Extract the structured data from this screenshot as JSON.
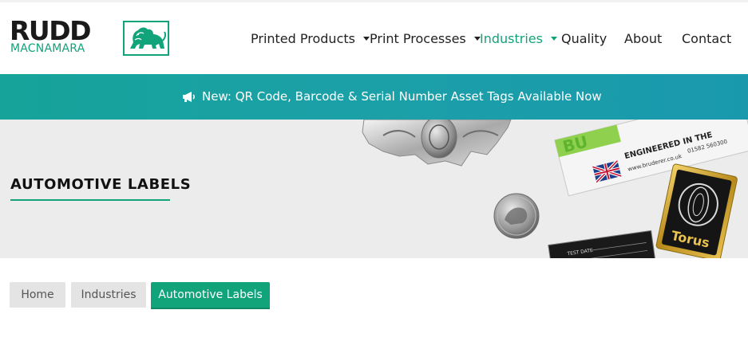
{
  "brand": {
    "name_top": "RUDD",
    "name_bottom": "MACNAMARA",
    "accent_color": "#11a37a",
    "logo_icon": "lion-icon"
  },
  "nav": {
    "items": [
      {
        "label": "Printed Products",
        "dropdown": true,
        "active": false
      },
      {
        "label": "Print Processes",
        "dropdown": true,
        "active": false
      },
      {
        "label": "Industries",
        "dropdown": true,
        "active": true
      },
      {
        "label": "Quality",
        "dropdown": false,
        "active": false
      },
      {
        "label": "About",
        "dropdown": false,
        "active": false
      },
      {
        "label": "Contact",
        "dropdown": false,
        "active": false
      }
    ]
  },
  "announcement": {
    "icon": "megaphone-icon",
    "text": "New: QR Code, Barcode & Serial Number Asset Tags Available Now",
    "background": "#1aa0a6"
  },
  "hero": {
    "title": "AUTOMOTIVE LABELS",
    "label_texts": {
      "engineered": "ENGINEERED IN THE",
      "website": "www.bruderer.co.uk",
      "phone": "01582 560300",
      "test_date": "TEST DATE",
      "torus": "Torus"
    }
  },
  "breadcrumb": {
    "items": [
      {
        "label": "Home",
        "current": false
      },
      {
        "label": "Industries",
        "current": false
      },
      {
        "label": "Automotive Labels",
        "current": true
      }
    ]
  }
}
